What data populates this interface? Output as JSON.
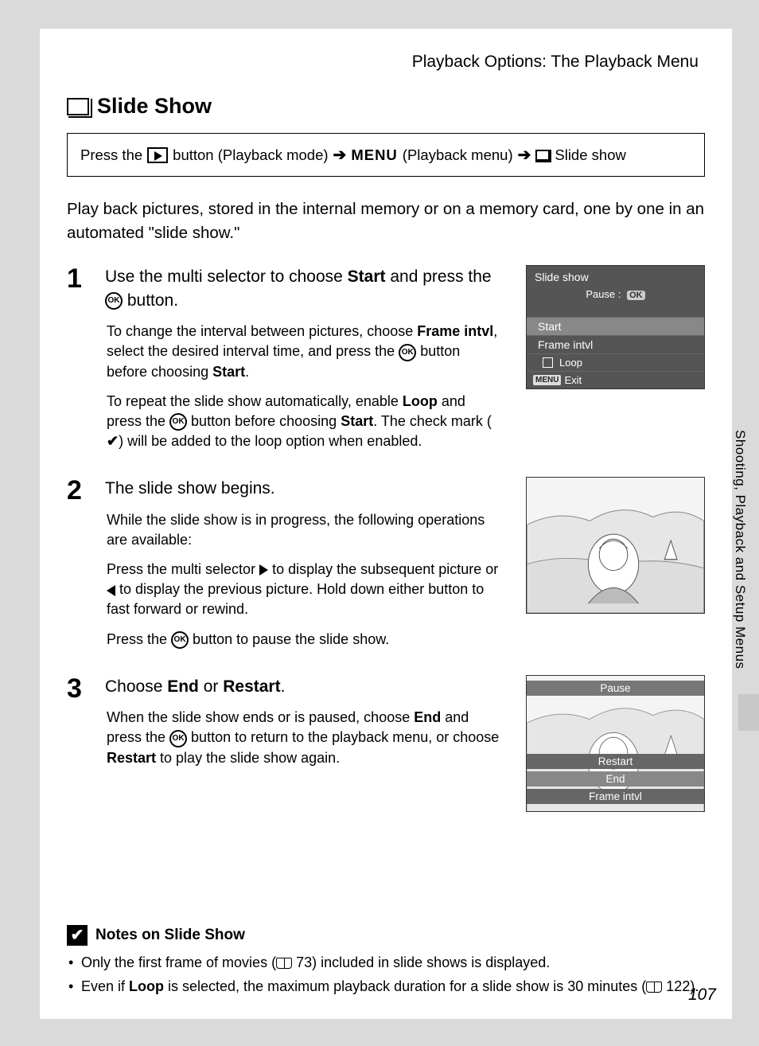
{
  "header": {
    "breadcrumb": "Playback Options: The Playback Menu"
  },
  "title": "Slide Show",
  "instruction": {
    "part1": "Press the",
    "part2": "button (Playback mode)",
    "menu_label": "MENU",
    "part3": "(Playback menu)",
    "part4": "Slide show"
  },
  "intro": "Play back pictures, stored in the internal memory or on a memory card, one by one in an automated \"slide show.\"",
  "steps": {
    "one": {
      "num": "1",
      "head_a": "Use the multi selector to choose ",
      "head_bold": "Start",
      "head_b": " and press the ",
      "head_c": " button.",
      "p1_a": "To change the interval between pictures, choose ",
      "p1_bold1": "Frame intvl",
      "p1_b": ", select the desired interval time, and press the ",
      "p1_c": " button before choosing ",
      "p1_bold2": "Start",
      "p1_d": ".",
      "p2_a": "To repeat the slide show automatically, enable ",
      "p2_bold1": "Loop",
      "p2_b": " and press the ",
      "p2_c": " button before choosing ",
      "p2_bold2": "Start",
      "p2_d": ". The check mark (",
      "p2_e": ") will be added to the loop option when enabled."
    },
    "two": {
      "num": "2",
      "head": "The slide show begins.",
      "p1": "While the slide show is in progress, the following operations are available:",
      "p2_a": "Press the multi selector ",
      "p2_b": " to display the subsequent picture or ",
      "p2_c": " to display the previous picture. Hold down either button to fast forward or rewind.",
      "p3_a": "Press the ",
      "p3_b": " button to pause the slide show."
    },
    "three": {
      "num": "3",
      "head_a": "Choose ",
      "head_bold1": "End",
      "head_b": " or ",
      "head_bold2": "Restart",
      "head_c": ".",
      "p1_a": "When the slide show ends or is paused, choose ",
      "p1_bold1": "End",
      "p1_b": " and press the ",
      "p1_c": " button to return to the playback menu, or choose ",
      "p1_bold2": "Restart",
      "p1_d": " to play the slide show again."
    }
  },
  "lcd1": {
    "title": "Slide show",
    "pause": "Pause",
    "ok": "OK",
    "start": "Start",
    "frame": "Frame intvl",
    "loop": "Loop",
    "menu": "MENU",
    "exit": "Exit"
  },
  "lcd3": {
    "pause": "Pause",
    "restart": "Restart",
    "end": "End",
    "frame": "Frame intvl"
  },
  "side_tab": "Shooting, Playback and Setup Menus",
  "notes": {
    "title": "Notes on Slide Show",
    "n1_a": "Only the first frame of movies (",
    "n1_ref": " 73) included in slide shows is displayed.",
    "n2_a": "Even if ",
    "n2_bold": "Loop",
    "n2_b": " is selected, the maximum playback duration for a slide show is 30 minutes (",
    "n2_ref": " 122)."
  },
  "page_num": "107",
  "glyphs": {
    "ok": "OK",
    "check": "✔"
  }
}
